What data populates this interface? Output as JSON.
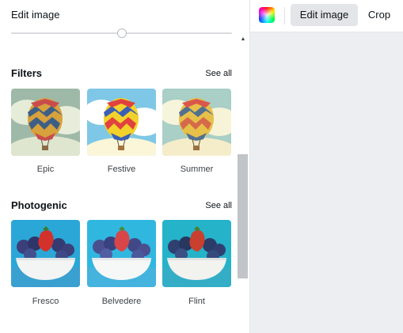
{
  "panel": {
    "title": "Edit image"
  },
  "adjust_slider": {
    "level_fraction": 0.5
  },
  "filters": {
    "title": "Filters",
    "see_all": "See all",
    "items": [
      {
        "label": "Epic"
      },
      {
        "label": "Festive"
      },
      {
        "label": "Summer"
      }
    ]
  },
  "photogenic": {
    "title": "Photogenic",
    "see_all": "See all",
    "items": [
      {
        "label": "Fresco"
      },
      {
        "label": "Belvedere"
      },
      {
        "label": "Flint"
      }
    ]
  },
  "toolbar": {
    "edit_image_label": "Edit image",
    "crop_label": "Crop"
  }
}
